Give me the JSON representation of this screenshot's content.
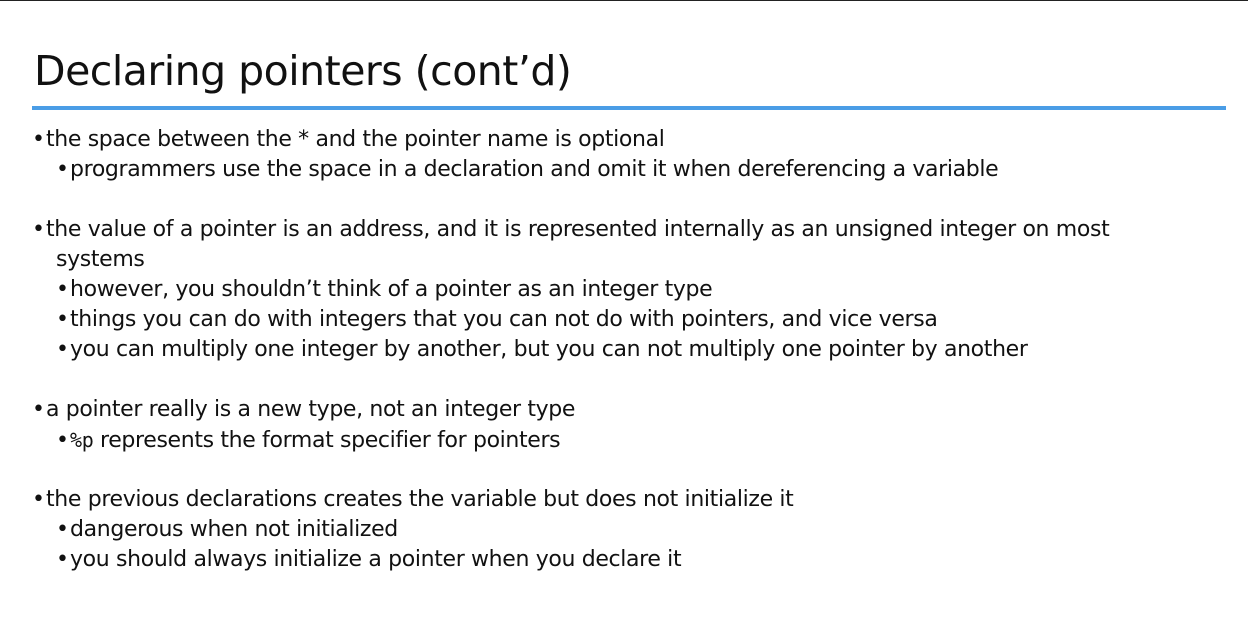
{
  "slide": {
    "title": "Declaring pointers (cont’d)"
  },
  "bullet_glyph": "•",
  "bullets": [
    {
      "text": "the space between the * and the pointer name is optional"
    },
    {
      "text": "programmers use the space in a declaration and omit it when dereferencing a variable"
    },
    {
      "text": "the value of a pointer is an address, and it is represented internally as an unsigned integer on most"
    },
    {
      "text": "systems"
    },
    {
      "text": "however, you shouldn’t think of a pointer as an integer type"
    },
    {
      "text": "things you can do with integers that you can not do with pointers, and vice versa"
    },
    {
      "text": "you can multiply one integer by another, but you can not multiply one pointer by another"
    },
    {
      "text": "a pointer really is a new type, not an integer type"
    },
    {
      "code": "%p",
      "text": " represents the format specifier for pointers"
    },
    {
      "text": "the previous declarations creates the variable but does not initialize it"
    },
    {
      "text": "dangerous when not initialized"
    },
    {
      "text": "you should always initialize a pointer when you declare it"
    }
  ]
}
